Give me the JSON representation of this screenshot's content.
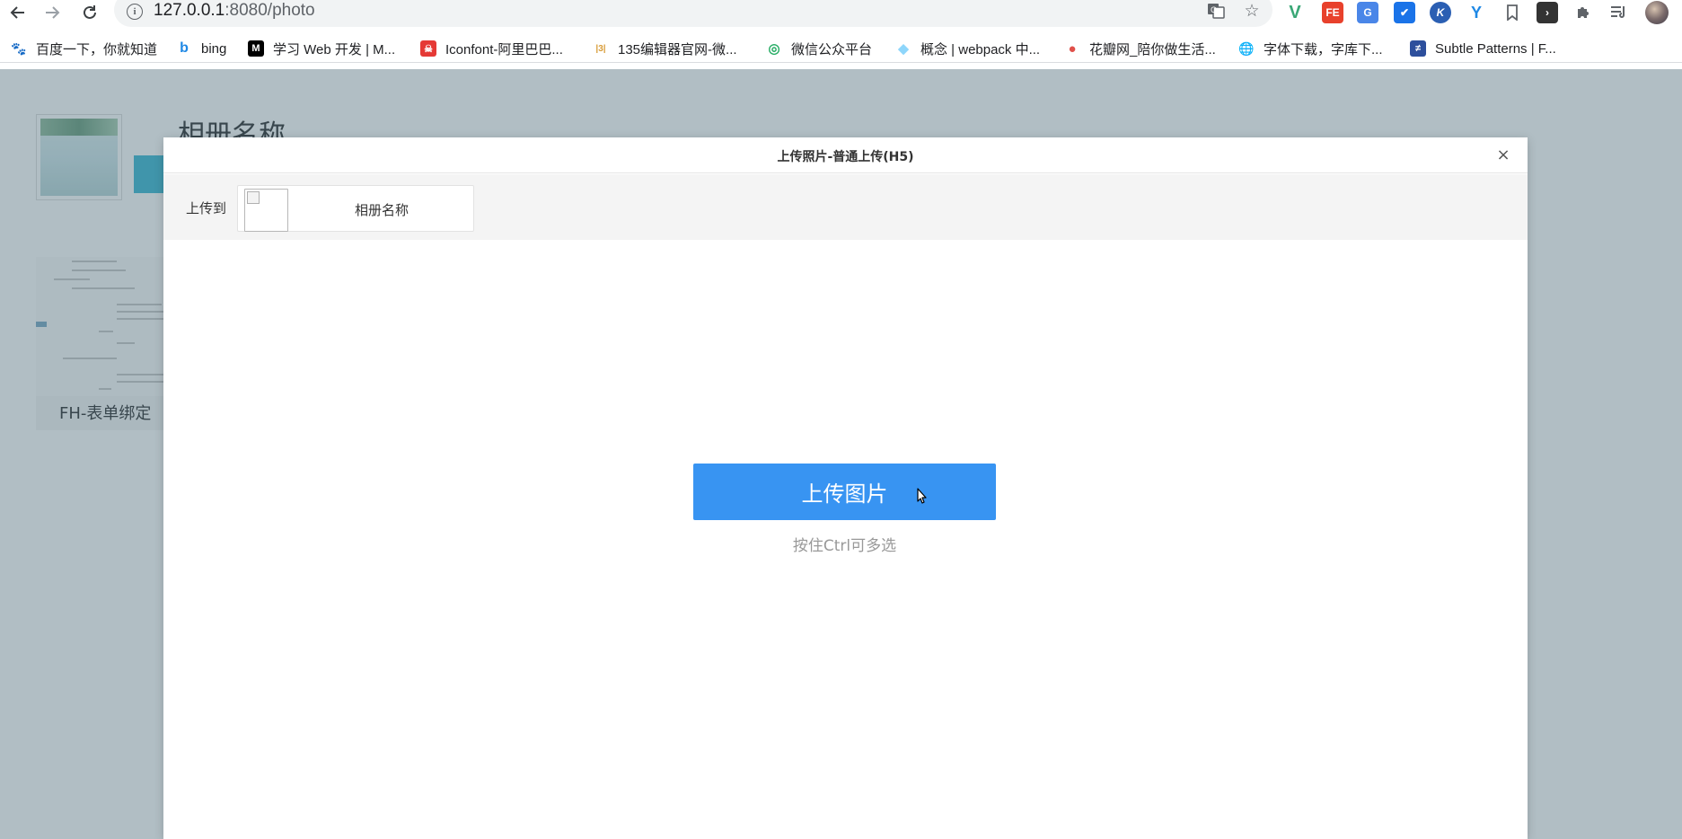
{
  "browser": {
    "url_host": "127.0.0.1",
    "url_rest": ":8080/photo",
    "icons": {
      "back": "back-arrow-icon",
      "forward": "forward-arrow-icon",
      "reload": "reload-icon",
      "site_info": "info-icon",
      "translate": "translate-icon",
      "star": "bookmark-star-icon"
    },
    "site_info_glyph": "i",
    "extensions": [
      {
        "name": "vue-devtools",
        "glyph": "V",
        "color": "#3aa776"
      },
      {
        "name": "fe-helper",
        "glyph": "FE",
        "color": "#e8412c"
      },
      {
        "name": "google-translate",
        "glyph": "G",
        "color": "#4a86e8"
      },
      {
        "name": "dropbox",
        "glyph": "✔",
        "color": "#1a73e8"
      },
      {
        "name": "k-extension",
        "glyph": "K",
        "color": "#2b5fb3"
      },
      {
        "name": "y-extension",
        "glyph": "Y",
        "color": "#1e88e5"
      },
      {
        "name": "bookmark",
        "glyph": "",
        "color": "#5f6368"
      },
      {
        "name": "dark-extension",
        "glyph": "›",
        "color": "#333333"
      },
      {
        "name": "puzzle",
        "glyph": "",
        "color": "#5f6368"
      },
      {
        "name": "media",
        "glyph": "",
        "color": "#5f6368"
      }
    ],
    "bookmarks": [
      {
        "label": "百度一下，你就知道",
        "icon": "baidu-icon",
        "color": "#2e6bff",
        "glyph": "🐾"
      },
      {
        "label": "bing",
        "icon": "bing-icon",
        "color": "#1e88e5",
        "glyph": "b"
      },
      {
        "label": "学习 Web 开发 | M...",
        "icon": "mdn-icon",
        "color": "#000000",
        "glyph": "M"
      },
      {
        "label": "Iconfont-阿里巴巴...",
        "icon": "iconfont-icon",
        "color": "#e53935",
        "glyph": "☠"
      },
      {
        "label": "135编辑器官网-微...",
        "icon": "editor135-icon",
        "color": "#d89c38",
        "glyph": "|3|"
      },
      {
        "label": "微信公众平台",
        "icon": "wechat-icon",
        "color": "#2aae67",
        "glyph": "◎"
      },
      {
        "label": "概念 | webpack 中...",
        "icon": "webpack-icon",
        "color": "#8ed6fb",
        "glyph": "◆"
      },
      {
        "label": "花瓣网_陪你做生活...",
        "icon": "huaban-icon",
        "color": "#e0504a",
        "glyph": "●"
      },
      {
        "label": "字体下载，字库下...",
        "icon": "globe-icon",
        "color": "#202124",
        "glyph": "🌐"
      },
      {
        "label": "Subtle Patterns | F...",
        "icon": "subtle-patterns-icon",
        "color": "#2d4f9c",
        "glyph": "≠"
      }
    ]
  },
  "page": {
    "album_title": "相册名称",
    "photos": [
      {
        "caption": "FH-表单绑定"
      }
    ]
  },
  "dialog": {
    "title": "上传照片-普通上传(H5)",
    "close_glyph": "×",
    "upload_to_label": "上传到",
    "album_name": "相册名称",
    "upload_button_label": "上传图片",
    "hint": "按住Ctrl可多选"
  }
}
